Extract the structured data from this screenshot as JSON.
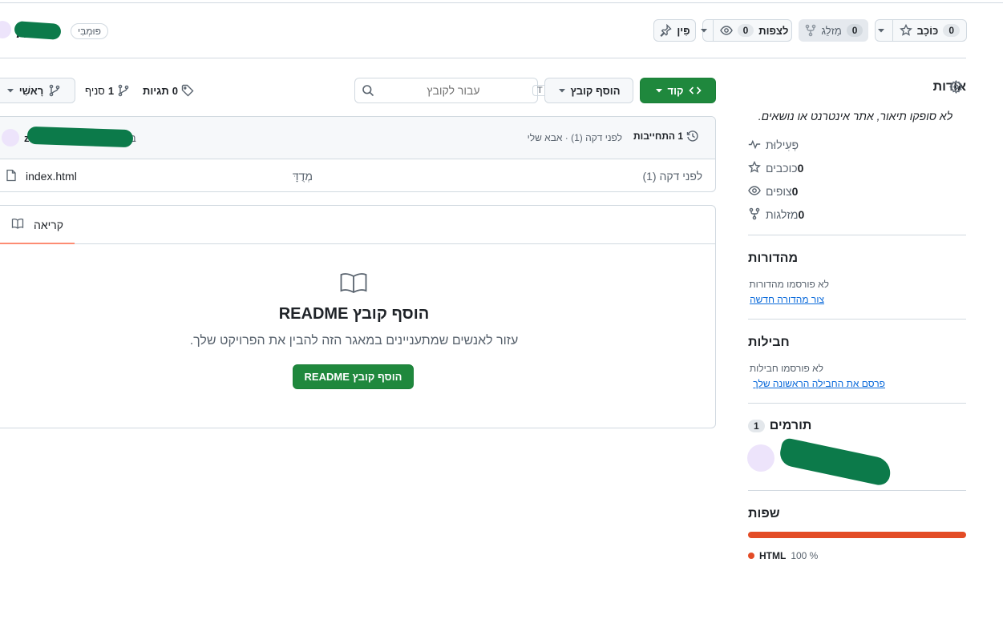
{
  "header": {
    "repo_name": "א",
    "visibility_badge": "פּוּמְבִּי",
    "pin_label": "פִּין",
    "watch_label": "לצפות",
    "watch_count": "0",
    "fork_label": "מַזלֵג",
    "fork_count": "0",
    "star_label": "כּוֹכָב",
    "star_count": "0"
  },
  "toolbar": {
    "branch_label": "רָאשִׁי",
    "branches_count": "1",
    "branches_label": "סניף",
    "tags_count": "0",
    "tags_label": "תגיות",
    "search_placeholder": "עבור לקובץ",
    "search_shortcut": "T",
    "add_file_label": "הוסף קובץ",
    "code_label": "קוד"
  },
  "commit_bar": {
    "author_suffix": "z",
    "author_initial": "ב",
    "meta": "לפני דקה (1) · אבא שלי",
    "commits_label": "1 התחייבות"
  },
  "files": [
    {
      "name": "index.html",
      "message": "מְדֻדָּ",
      "time": "לפני דקה (1)"
    }
  ],
  "readme": {
    "tab_label": "קריאה",
    "title": "הוסף קובץ README",
    "description": "עזור לאנשים שמתעניינים במאגר הזה להבין את הפרויקט שלך.",
    "button_label": "הוסף קובץ README"
  },
  "sidebar": {
    "about_title": "אודות",
    "about_description": "לא סופקו תיאור, אתר אינטרנט או נושאים.",
    "activity_label": "פְּעִילוּת",
    "stars_count": "0",
    "stars_label": "כוכבים",
    "watchers_count": "0",
    "watchers_label": "צופים",
    "forks_count": "0",
    "forks_label": "מזלגות",
    "releases_title": "מהדורות",
    "releases_empty": "לא פורסמו מהדורות",
    "releases_link": "צור מהדורה חדשה",
    "packages_title": "חבילות",
    "packages_empty": "לא פורסמו חבילות",
    "packages_link": "פרסם את החבילה הראשונה שלך",
    "contributors_title": "תורמים",
    "contributors_count": "1",
    "languages_title": "שפות",
    "language_name": "HTML",
    "language_percent": "100 %",
    "language_fraction": 1.0
  },
  "colors": {
    "primary_green": "#1f883d",
    "html_language": "#e34c26",
    "underline_accent": "#fd8c73",
    "avatar_bg": "#ede4fb"
  }
}
